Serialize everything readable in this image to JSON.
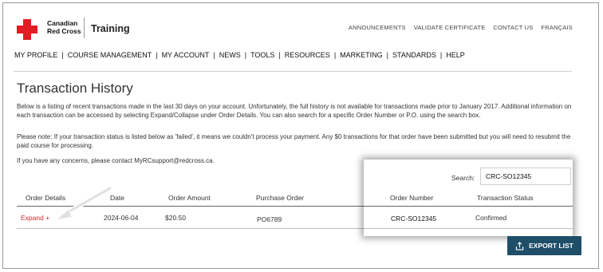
{
  "brand": {
    "line1": "Canadian",
    "line2": "Red Cross",
    "product": "Training"
  },
  "topnav": [
    "ANNOUNCEMENTS",
    "VALIDATE CERTIFICATE",
    "CONTACT US",
    "FRANÇAIS"
  ],
  "mainnav": [
    "MY PROFILE",
    "COURSE MANAGEMENT",
    "MY ACCOUNT",
    "NEWS",
    "TOOLS",
    "RESOURCES",
    "MARKETING",
    "STANDARDS",
    "HELP"
  ],
  "page": {
    "title": "Transaction History",
    "para1": "Below is a listing of recent transactions made in the last 30 days on your account. Unfortunately, the full history is not available for transactions made prior to January 2017. Additional information on each transaction can be accessed by selecting Expand/Collapse under Order Details. You can also search for a specific Order Number or P.O. using the search box.",
    "para2": "Please note: If your transaction status is listed below as 'failed', it means we couldn't process your payment. Any $0 transactions for that order have been submitted but you will need to resubmit the paid course for processing.",
    "para3": "If you have any concerns, please contact MyRCsupport@redcross.ca."
  },
  "search": {
    "label": "Search:",
    "value": "CRC-SO12345"
  },
  "table": {
    "headers": {
      "order_details": "Order Details",
      "date": "Date",
      "order_amount": "Order Amount",
      "purchase_order": "Purchase Order",
      "order_number": "Order Number",
      "transaction_status": "Transaction Status"
    },
    "rows": [
      {
        "expand": "Expand +",
        "date": "2024-06-04",
        "amount": "$20.50",
        "purchase_order": "PO6789",
        "order_number": "CRC-SO12345",
        "status": "Confirmed"
      }
    ]
  },
  "export": {
    "label": "EXPORT LIST",
    "icon": "export-icon"
  },
  "colors": {
    "brand_red": "#e31b23",
    "export_bg": "#1f4e68",
    "link_red": "#d9262b"
  }
}
